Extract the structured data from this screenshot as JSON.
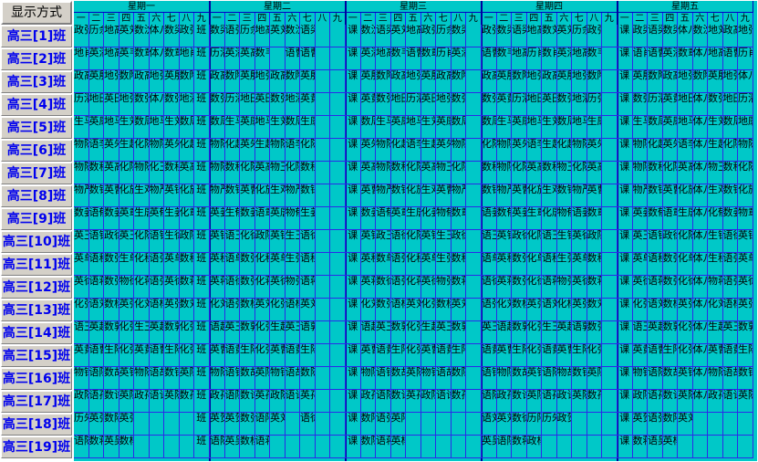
{
  "mode_button": "显示方式",
  "days": [
    {
      "label": "星期一"
    },
    {
      "label": "星期二"
    },
    {
      "label": "星期三"
    },
    {
      "label": "星期四"
    },
    {
      "label": "星期五"
    }
  ],
  "periods": [
    "一",
    "二",
    "三",
    "四",
    "五",
    "六",
    "七",
    "八",
    "九"
  ],
  "classes": [
    {
      "label": "高三[1]班"
    },
    {
      "label": "高三[2]班"
    },
    {
      "label": "高三[3]班"
    },
    {
      "label": "高三[4]班"
    },
    {
      "label": "高三[5]班"
    },
    {
      "label": "高三[6]班"
    },
    {
      "label": "高三[7]班"
    },
    {
      "label": "高三[8]班"
    },
    {
      "label": "高三[9]班"
    },
    {
      "label": "高三[10]班"
    },
    {
      "label": "高三[11]班"
    },
    {
      "label": "高三[12]班"
    },
    {
      "label": "高三[13]班"
    },
    {
      "label": "高三[14]班"
    },
    {
      "label": "高三[15]班"
    },
    {
      "label": "高三[16]班"
    },
    {
      "label": "高三[17]班"
    },
    {
      "label": "高三[18]班"
    },
    {
      "label": "高三[19]班"
    }
  ],
  "schedule": [
    [
      [
        "政张",
        "历余",
        "地高",
        "英刘",
        "数沈",
        "体八",
        "数梁",
        "政张",
        "班"
      ],
      [
        "数梁",
        "语张",
        "历余",
        "地高",
        "英刘",
        "数沈",
        "语梁",
        "",
        ""
      ],
      [
        "课",
        "数沈",
        "语梁",
        "英刘",
        "地高",
        "政张",
        "历余",
        "数梁",
        ""
      ],
      [
        "政张",
        "数梁",
        "语梁",
        "地高",
        "数刘",
        "英刘",
        "历余",
        "政张",
        ""
      ],
      [
        "课",
        "政梁",
        "语梁",
        "数梁",
        "体八",
        "数沈",
        "地刘",
        "政高",
        "地张"
      ]
    ],
    [
      [
        "地肖",
        "英潘",
        "地高",
        "英韦",
        "数章",
        "体八",
        "数章",
        "地肖",
        "班"
      ],
      [
        "历潘",
        "英潘",
        "英高",
        "数韦",
        "",
        "语曹",
        "语曹",
        "",
        ""
      ],
      [
        "课",
        "英潘",
        "地高",
        "数韦",
        "语曹",
        "数章",
        "历肖",
        "英潘",
        ""
      ],
      [
        "语曹",
        "数韦",
        "地高",
        "历肖",
        "数肖",
        "英潘",
        "地高",
        "数韦",
        ""
      ],
      [
        "课",
        "语肖",
        "语曹",
        "英潘",
        "数章",
        "体八",
        "地高",
        "语曹",
        "历肖"
      ]
    ],
    [
      [
        "政高",
        "英殷",
        "地张",
        "数陶",
        "政高",
        "地张",
        "英殷",
        "数陶",
        "班"
      ],
      [
        "政高",
        "数陶",
        "英殷",
        "地张",
        "政高",
        "数陶",
        "英殷",
        "",
        ""
      ],
      [
        "课",
        "英殷",
        "数陶",
        "政高",
        "地张",
        "英殷",
        "政高",
        "数陶",
        ""
      ],
      [
        "政高",
        "英殷",
        "数陶",
        "地张",
        "政高",
        "英殷",
        "地张",
        "数陶",
        ""
      ],
      [
        "课",
        "英殷",
        "数陶",
        "政高",
        "地张",
        "数陶",
        "英殷",
        "地张",
        "体八"
      ]
    ],
    [
      [
        "历潘",
        "地田",
        "英田",
        "地张",
        "数张",
        "体八",
        "数张",
        "地潘",
        "班"
      ],
      [
        "数张",
        "历潘",
        "地田",
        "英田",
        "数张",
        "地潘",
        "英黄",
        "",
        ""
      ],
      [
        "课",
        "英黄",
        "数张",
        "地田",
        "历潘",
        "英田",
        "地张",
        "数张",
        ""
      ],
      [
        "数张",
        "英黄",
        "历潘",
        "地田",
        "英田",
        "数张",
        "地潘",
        "历张",
        ""
      ],
      [
        "课",
        "数张",
        "历潘",
        "英黄",
        "地田",
        "体八",
        "数张",
        "地田",
        "历潘"
      ]
    ],
    [
      [
        "生马",
        "英康",
        "地马",
        "生刘",
        "数周",
        "地马",
        "生刘",
        "数周",
        "班"
      ],
      [
        "数周",
        "生马",
        "英康",
        "地马",
        "生刘",
        "数周",
        "生康",
        "",
        ""
      ],
      [
        "课",
        "数周",
        "生马",
        "英康",
        "地马",
        "生刘",
        "英康",
        "数周",
        ""
      ],
      [
        "数周",
        "生马",
        "英康",
        "地马",
        "生刘",
        "数周",
        "地马",
        "生康",
        ""
      ],
      [
        "课",
        "生马",
        "数周",
        "英康",
        "地马",
        "体八",
        "生刘",
        "数周",
        "地康"
      ]
    ],
    [
      [
        "物陈",
        "语李",
        "英朱",
        "生赵",
        "化陈",
        "物陈",
        "英朱",
        "化赵",
        "班"
      ],
      [
        "物陈",
        "化赵",
        "英朱",
        "生赵",
        "物陈",
        "语李",
        "化陈",
        "",
        ""
      ],
      [
        "课",
        "英朱",
        "物陈",
        "化赵",
        "语李",
        "生赵",
        "英朱",
        "物陈",
        ""
      ],
      [
        "化陈",
        "物陈",
        "英朱",
        "语李",
        "生赵",
        "化赵",
        "物陈",
        "英朱",
        ""
      ],
      [
        "课",
        "物陈",
        "化赵",
        "英朱",
        "语李",
        "体八",
        "生赵",
        "化陈",
        "物陈"
      ]
    ],
    [
      [
        "物陈",
        "数程",
        "英高",
        "化陈",
        "物陈",
        "化王",
        "数程",
        "英高",
        "班"
      ],
      [
        "物陈",
        "数程",
        "化陈",
        "英高",
        "物王",
        "化陈",
        "数程",
        "",
        ""
      ],
      [
        "课",
        "英高",
        "物陈",
        "数程",
        "化陈",
        "英高",
        "物王",
        "化陈",
        ""
      ],
      [
        "数程",
        "物陈",
        "化陈",
        "英高",
        "数程",
        "物王",
        "化陈",
        "英高",
        ""
      ],
      [
        "课",
        "物陈",
        "数程",
        "化陈",
        "英高",
        "体八",
        "物王",
        "数程",
        "化陈"
      ]
    ],
    [
      [
        "物严",
        "数钱",
        "英曹",
        "化施",
        "生邓",
        "物严",
        "英钱",
        "化施",
        "班"
      ],
      [
        "物严",
        "数钱",
        "英曹",
        "化施",
        "生邓",
        "物严",
        "数钱",
        "",
        ""
      ],
      [
        "课",
        "英曹",
        "物严",
        "数钱",
        "化施",
        "生邓",
        "英曹",
        "物严",
        ""
      ],
      [
        "数钱",
        "物严",
        "英曹",
        "化施",
        "生邓",
        "数钱",
        "物严",
        "英曹",
        ""
      ],
      [
        "课",
        "物严",
        "数钱",
        "英曹",
        "化施",
        "体八",
        "生邓",
        "数钱",
        "化施"
      ]
    ],
    [
      [
        "数姜",
        "语郁",
        "数姜",
        "英章",
        "生唐",
        "英郁",
        "生姜",
        "化章",
        "班"
      ],
      [
        "英姜",
        "生郁",
        "数姜",
        "语章",
        "英唐",
        "物郁",
        "生姜",
        "",
        ""
      ],
      [
        "课",
        "数姜",
        "语郁",
        "英章",
        "生唐",
        "化姜",
        "物郁",
        "数章",
        ""
      ],
      [
        "语姜",
        "数郁",
        "英姜",
        "生章",
        "化唐",
        "物郁",
        "语姜",
        "数章",
        ""
      ],
      [
        "课",
        "英姜",
        "数郁",
        "语章",
        "生唐",
        "体八",
        "化郁",
        "数姜",
        "物章"
      ]
    ],
    [
      [
        "英王",
        "语钱",
        "政徐",
        "英王",
        "化陈",
        "语钱",
        "生徐",
        "政陈",
        "班"
      ],
      [
        "英钱",
        "语王",
        "化徐",
        "政陈",
        "英钱",
        "生王",
        "语徐",
        "",
        ""
      ],
      [
        "课",
        "英钱",
        "政王",
        "语徐",
        "化陈",
        "英钱",
        "生王",
        "政徐",
        ""
      ],
      [
        "语王",
        "英钱",
        "政徐",
        "化陈",
        "语王",
        "生钱",
        "英徐",
        "政陈",
        ""
      ],
      [
        "课",
        "英王",
        "语钱",
        "政徐",
        "化陈",
        "体八",
        "生钱",
        "语徐",
        "英钱"
      ]
    ],
    [
      [
        "英单",
        "语程",
        "数张",
        "生单",
        "化程",
        "语张",
        "英单",
        "数程",
        "班"
      ],
      [
        "英程",
        "语单",
        "数张",
        "化程",
        "英单",
        "生张",
        "语程",
        "",
        ""
      ],
      [
        "课",
        "英程",
        "数单",
        "语张",
        "化程",
        "英单",
        "生张",
        "数程",
        ""
      ],
      [
        "语单",
        "英程",
        "数张",
        "化单",
        "语程",
        "生张",
        "英单",
        "数程",
        ""
      ],
      [
        "课",
        "英单",
        "语程",
        "数张",
        "化单",
        "体八",
        "生程",
        "语张",
        "英单"
      ]
    ],
    [
      [
        "英徐",
        "语蒋",
        "数张",
        "物徐",
        "化蒋",
        "语张",
        "英徐",
        "数蒋",
        "班"
      ],
      [
        "英蒋",
        "语徐",
        "数张",
        "化蒋",
        "英徐",
        "物张",
        "语蒋",
        "",
        ""
      ],
      [
        "课",
        "英蒋",
        "数徐",
        "语张",
        "化蒋",
        "英徐",
        "物张",
        "数蒋",
        ""
      ],
      [
        "语徐",
        "英蒋",
        "数张",
        "化徐",
        "语蒋",
        "物张",
        "英徐",
        "数蒋",
        ""
      ],
      [
        "课",
        "英徐",
        "语蒋",
        "数张",
        "化徐",
        "体八",
        "物蒋",
        "语张",
        "英徐"
      ]
    ],
    [
      [
        "化张",
        "语刘",
        "数杨",
        "英张",
        "化刘",
        "语杨",
        "英张",
        "数刘",
        "班"
      ],
      [
        "化刘",
        "语张",
        "数杨",
        "英刘",
        "化张",
        "语杨",
        "英刘",
        "",
        ""
      ],
      [
        "课",
        "化刘",
        "数张",
        "语杨",
        "英刘",
        "化张",
        "数杨",
        "英刘",
        ""
      ],
      [
        "语张",
        "化刘",
        "数杨",
        "英张",
        "语刘",
        "化杨",
        "英张",
        "数刘",
        ""
      ],
      [
        "课",
        "化张",
        "语刘",
        "数杨",
        "英张",
        "体八",
        "化刘",
        "语杨",
        "英张"
      ]
    ],
    [
      [
        "语王",
        "英赵",
        "数郭",
        "化张",
        "生王",
        "英赵",
        "数郭",
        "化张",
        "班"
      ],
      [
        "语赵",
        "英王",
        "数郭",
        "化张",
        "生赵",
        "英王",
        "语郭",
        "",
        ""
      ],
      [
        "课",
        "语赵",
        "英王",
        "数郭",
        "化张",
        "生赵",
        "英王",
        "数郭",
        ""
      ],
      [
        "英王",
        "语赵",
        "数郭",
        "化张",
        "生王",
        "英赵",
        "语郭",
        "数张",
        ""
      ],
      [
        "课",
        "语王",
        "英赵",
        "数郭",
        "化张",
        "体八",
        "生赵",
        "英王",
        "数郭"
      ]
    ],
    [
      [
        "英黄",
        "语曹",
        "生陆",
        "化张",
        "英黄",
        "语曹",
        "生陆",
        "化张",
        "班"
      ],
      [
        "英曹",
        "语黄",
        "生陆",
        "化张",
        "英曹",
        "语黄",
        "生陆",
        "",
        ""
      ],
      [
        "课",
        "英曹",
        "语黄",
        "生陆",
        "化张",
        "英曹",
        "语黄",
        "生陆",
        ""
      ],
      [
        "语黄",
        "英曹",
        "生陆",
        "化张",
        "语黄",
        "英曹",
        "生陆",
        "化张",
        ""
      ],
      [
        "课",
        "英黄",
        "语曹",
        "生陆",
        "化张",
        "体八",
        "英曹",
        "语黄",
        "生陆"
      ]
    ],
    [
      [
        "物钟",
        "语陈",
        "数胡",
        "英钟",
        "物陈",
        "语胡",
        "数钟",
        "英陈",
        "班"
      ],
      [
        "物陈",
        "语钟",
        "数胡",
        "英陈",
        "物钟",
        "语胡",
        "数陈",
        "",
        ""
      ],
      [
        "课",
        "物陈",
        "语钟",
        "数胡",
        "英陈",
        "物钟",
        "语胡",
        "数陈",
        ""
      ],
      [
        "语钟",
        "物陈",
        "数胡",
        "英钟",
        "语陈",
        "物胡",
        "数钟",
        "英陈",
        ""
      ],
      [
        "课",
        "物钟",
        "语陈",
        "数胡",
        "英钟",
        "体八",
        "物陈",
        "语胡",
        "数钟"
      ]
    ],
    [
      [
        "政陈",
        "语孙",
        "数许",
        "英陈",
        "政孙",
        "语许",
        "英陈",
        "数孙",
        "班"
      ],
      [
        "政孙",
        "语陈",
        "数许",
        "英孙",
        "政陈",
        "语许",
        "英孙",
        "",
        ""
      ],
      [
        "课",
        "政孙",
        "语陈",
        "数许",
        "英孙",
        "政陈",
        "语许",
        "数孙",
        ""
      ],
      [
        "语陈",
        "政孙",
        "数许",
        "英陈",
        "语孙",
        "政许",
        "英陈",
        "数孙",
        ""
      ],
      [
        "课",
        "政陈",
        "语孙",
        "数许",
        "英陈",
        "体八",
        "政孙",
        "语许",
        "英陈"
      ]
    ],
    [
      [
        "历朱",
        "英张",
        "数陆",
        "英张",
        "",
        "",
        "",
        "",
        "班"
      ],
      [
        "英贺",
        "英贺",
        "数张",
        "语陆",
        "英刘",
        "",
        "语徐",
        "",
        ""
      ],
      [
        "课",
        "数陆",
        "语张",
        "英陆",
        "",
        "",
        "",
        "",
        ""
      ],
      [
        "语刘",
        "英刘",
        "数徐",
        "历陆",
        "历朱",
        "政贺",
        "",
        "",
        ""
      ],
      [
        "课",
        "英贺",
        "语张",
        "数陆",
        "英刘",
        "",
        "",
        "",
        ""
      ]
    ],
    [
      [
        "语陈",
        "数蒋",
        "英吴",
        "数杨",
        "",
        "",
        "",
        "",
        "班"
      ],
      [
        "语陈",
        "英吴",
        "数杨",
        "语蒋",
        "",
        "",
        "",
        "",
        ""
      ],
      [
        "课",
        "数陈",
        "语蒋",
        "英杨",
        "",
        "",
        "",
        "",
        ""
      ],
      [
        "英吴",
        "语陈",
        "数蒋",
        "政杨",
        "",
        "",
        "",
        "",
        ""
      ],
      [
        "课",
        "数蒋",
        "语吴",
        "英杨",
        "",
        "",
        "",
        "",
        ""
      ]
    ]
  ]
}
